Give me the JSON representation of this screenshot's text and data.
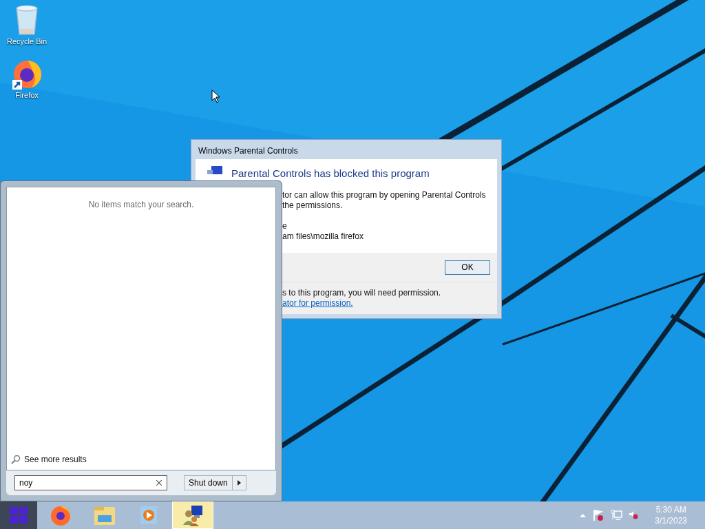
{
  "desktop_icons": [
    {
      "label": "Recycle Bin",
      "kind": "recycle"
    },
    {
      "label": "Firefox",
      "kind": "firefox"
    }
  ],
  "dialog": {
    "title": "Windows Parental Controls",
    "heading": "Parental Controls has blocked this program",
    "body_lines": [
      "tor can allow this program by opening Parental Controls",
      "the permissions."
    ],
    "detail_lines": [
      "e",
      "am files\\mozilla firefox"
    ],
    "ok_button": "OK",
    "footer_text": "s to this program, you will need permission.",
    "footer_link": "ator for permission."
  },
  "start_menu": {
    "message": "No items match your search.",
    "see_more": "See more results",
    "search": {
      "value": "noy"
    },
    "shutdown_button": "Shut down"
  },
  "taskbar": {
    "items": [
      {
        "kind": "firefox",
        "selected": false
      },
      {
        "kind": "explorer",
        "selected": false
      },
      {
        "kind": "media",
        "selected": false
      },
      {
        "kind": "parental",
        "selected": true
      }
    ],
    "clock": {
      "time": "5:30 AM",
      "date": "3/1/2023"
    }
  }
}
